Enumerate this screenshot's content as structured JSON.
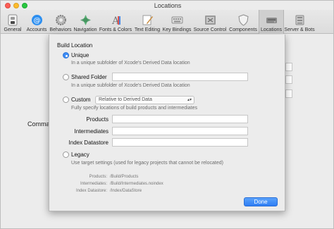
{
  "window": {
    "title": "Locations"
  },
  "toolbar": {
    "items": [
      {
        "label": "General",
        "icon": "switch-icon"
      },
      {
        "label": "Accounts",
        "icon": "at-icon"
      },
      {
        "label": "Behaviors",
        "icon": "gear-icon"
      },
      {
        "label": "Navigation",
        "icon": "compass-icon"
      },
      {
        "label": "Fonts & Colors",
        "icon": "fonts-colors-icon"
      },
      {
        "label": "Text Editing",
        "icon": "pencil-icon"
      },
      {
        "label": "Key Bindings",
        "icon": "keyboard-icon"
      },
      {
        "label": "Source Control",
        "icon": "source-control-icon"
      },
      {
        "label": "Components",
        "icon": "shield-icon"
      },
      {
        "label": "Locations",
        "icon": "drive-icon",
        "selected": true
      },
      {
        "label": "Server & Bots",
        "icon": "server-icon"
      }
    ]
  },
  "background": {
    "label": "Comman"
  },
  "sheet": {
    "title": "Build Location",
    "options": {
      "unique": {
        "label": "Unique",
        "description": "In a unique subfolder of Xcode's Derived Data location",
        "checked": true
      },
      "shared": {
        "label": "Shared Folder",
        "value": "",
        "description": "In a unique subfolder of Xcode's Derived Data location"
      },
      "custom": {
        "label": "Custom",
        "popup_value": "Relative to Derived Data",
        "description": "Fully specify locations of build products and intermediates"
      },
      "legacy": {
        "label": "Legacy",
        "description": "Use target settings (used for legacy projects that cannot be relocated)"
      }
    },
    "fields": {
      "products": {
        "label": "Products",
        "value": ""
      },
      "intermediates": {
        "label": "Intermediates",
        "value": ""
      },
      "index_datastore": {
        "label": "Index Datastore",
        "value": ""
      }
    },
    "legacy_paths": {
      "products": {
        "label": "Products:",
        "value": "/Build/Products"
      },
      "intermediates": {
        "label": "Intermediates:",
        "value": "/Build/Intermediates.noindex"
      },
      "index_datastore": {
        "label": "Index Datastore:",
        "value": "/Index/DataStore"
      }
    },
    "done_label": "Done"
  },
  "colors": {
    "accent": "#3d8cf5",
    "selected_tab": "#cfcfcf"
  }
}
